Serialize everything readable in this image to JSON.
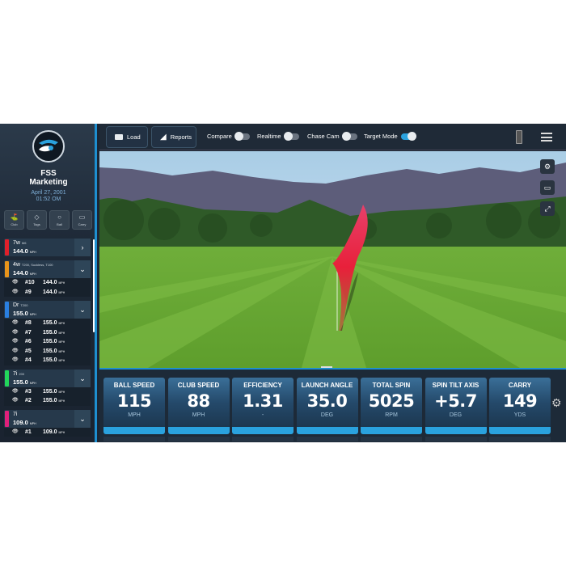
{
  "user": {
    "name_line1": "FSS",
    "name_line2": "Marketing",
    "date": "April 27, 2001",
    "time": "01:52 OM"
  },
  "filters": [
    {
      "label": "Club",
      "icon": "club-icon"
    },
    {
      "label": "Tags",
      "icon": "tag-icon"
    },
    {
      "label": "Ball",
      "icon": "ball-icon"
    },
    {
      "label": "Carry",
      "icon": "carry-icon"
    }
  ],
  "clubs": [
    {
      "club": "7w",
      "model": "M6",
      "speed": "144.0",
      "unit": "MPH",
      "color": "#e0202a",
      "expanded": false,
      "shots": []
    },
    {
      "club": "4w",
      "model": "T200, Suckless, T100",
      "speed": "144.0",
      "unit": "MPH",
      "color": "#e8941a",
      "expanded": true,
      "shots": [
        {
          "n": "#10",
          "v": "144.0"
        },
        {
          "n": "#9",
          "v": "144.0"
        }
      ]
    },
    {
      "club": "Dr",
      "model": "T200",
      "speed": "155.0",
      "unit": "MPH",
      "color": "#2a7fe0",
      "expanded": true,
      "shots": [
        {
          "n": "#8",
          "v": "155.0"
        },
        {
          "n": "#7",
          "v": "155.0"
        },
        {
          "n": "#6",
          "v": "155.0"
        },
        {
          "n": "#5",
          "v": "155.0"
        },
        {
          "n": "#4",
          "v": "155.0"
        }
      ]
    },
    {
      "club": "7i",
      "model": "200",
      "speed": "155.0",
      "unit": "MPH",
      "color": "#22d65a",
      "expanded": true,
      "shots": [
        {
          "n": "#3",
          "v": "155.0"
        },
        {
          "n": "#2",
          "v": "155.0"
        }
      ]
    },
    {
      "club": "7i",
      "model": "",
      "speed": "109.0",
      "unit": "MPH",
      "color": "#e0207a",
      "expanded": true,
      "shots": [
        {
          "n": "#1",
          "v": "109.0"
        }
      ]
    }
  ],
  "toolbar": {
    "load": "Load",
    "reports": "Reports",
    "toggles": [
      {
        "label": "Compare",
        "on": false
      },
      {
        "label": "Realtime",
        "on": false
      },
      {
        "label": "Chase Cam",
        "on": false
      },
      {
        "label": "Target Mode",
        "on": true
      }
    ]
  },
  "metrics": [
    {
      "title": "BALL SPEED",
      "value": "115",
      "unit": "MPH"
    },
    {
      "title": "CLUB SPEED",
      "value": "88",
      "unit": "MPH"
    },
    {
      "title": "EFFICIENCY",
      "value": "1.31",
      "unit": "-"
    },
    {
      "title": "LAUNCH ANGLE",
      "value": "35.0",
      "unit": "DEG"
    },
    {
      "title": "TOTAL SPIN",
      "value": "5025",
      "unit": "RPM"
    },
    {
      "title": "SPIN TILT AXIS",
      "value": "+5.7",
      "unit": "DEG"
    },
    {
      "title": "CARRY",
      "value": "149",
      "unit": "YDS"
    }
  ],
  "colors": {
    "accent": "#1e8fd0",
    "trajectory": "#e8203a"
  }
}
